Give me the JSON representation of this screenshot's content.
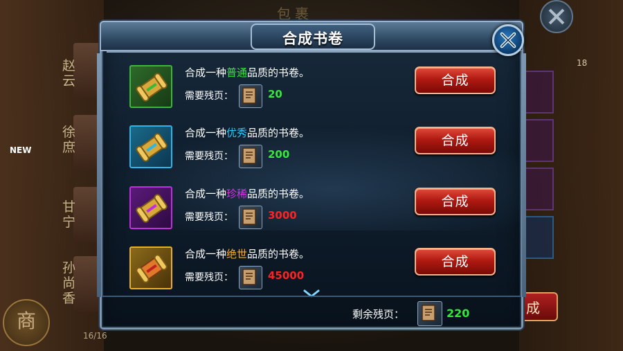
{
  "background": {
    "title": "包裹",
    "names": [
      "赵云",
      "徐庶",
      "甘宁",
      "孙尚香"
    ],
    "new_badge": "NEW",
    "count": "16/16",
    "top_count": "18",
    "right_button": "成",
    "side_button": "商"
  },
  "dialog": {
    "title": "合成书卷",
    "need_label": "需要残页：",
    "button_label": "合成",
    "rows": [
      {
        "prefix": "合成一种",
        "quality": "普通",
        "suffix": "品质的书卷。",
        "amount": "20"
      },
      {
        "prefix": "合成一种",
        "quality": "优秀",
        "suffix": "品质的书卷。",
        "amount": "200"
      },
      {
        "prefix": "合成一种",
        "quality": "珍稀",
        "suffix": "品质的书卷。",
        "amount": "3000"
      },
      {
        "prefix": "合成一种",
        "quality": "绝世",
        "suffix": "品质的书卷。",
        "amount": "45000"
      }
    ],
    "remaining_label": "剩余残页：",
    "remaining_amount": "220"
  },
  "colors": {
    "quality_common": "#36e83a",
    "quality_excellent": "#2ec6ff",
    "quality_rare": "#e22cf0",
    "quality_legendary": "#ffae1a",
    "amount_ok": "#36e83a",
    "amount_lacking": "#ff2222",
    "frame_common": "#3ab83a",
    "frame_excellent": "#2ab6e8",
    "frame_rare": "#c02ee0",
    "frame_legendary": "#e8b02a"
  },
  "icons": [
    "scroll-icon",
    "book-page-icon",
    "close-icon",
    "chevron-down-icon"
  ]
}
